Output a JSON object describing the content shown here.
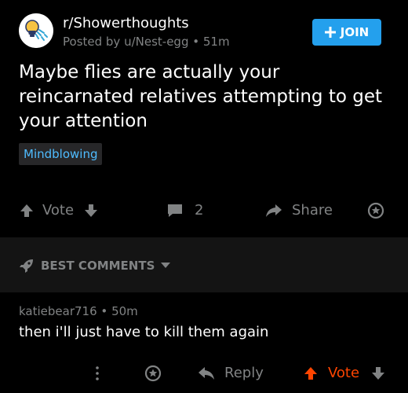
{
  "post": {
    "subreddit": "r/Showerthoughts",
    "posted_by": "Posted by u/Nest-egg",
    "separator": "•",
    "age": "51m",
    "join_label": "JOIN",
    "join_icon": "plus-icon",
    "title": "Maybe flies are actually your reincarnated relatives attempting to get your attention",
    "flair": "Mindblowing",
    "subreddit_icon": "lightbulb-shower-icon"
  },
  "actions": {
    "vote_label": "Vote",
    "comment_count": "2",
    "share_label": "Share",
    "icons": [
      "upvote-icon",
      "downvote-icon",
      "comment-icon",
      "share-icon",
      "award-icon"
    ]
  },
  "comments_header": {
    "sort_label": "BEST COMMENTS",
    "icons": [
      "rocket-icon",
      "caret-down-icon"
    ]
  },
  "comment": {
    "author": "katiebear716",
    "separator": "•",
    "age": "50m",
    "body": "then i'll just have to kill them again",
    "more_icon": "more-vertical-icon",
    "reply_label": "Reply",
    "vote_label": "Vote"
  },
  "colors": {
    "background": "#000000",
    "accent_blue": "#24a0ed",
    "flair_text": "#4fbcff",
    "upvoted_orange": "#ff4500",
    "muted": "#818384"
  }
}
